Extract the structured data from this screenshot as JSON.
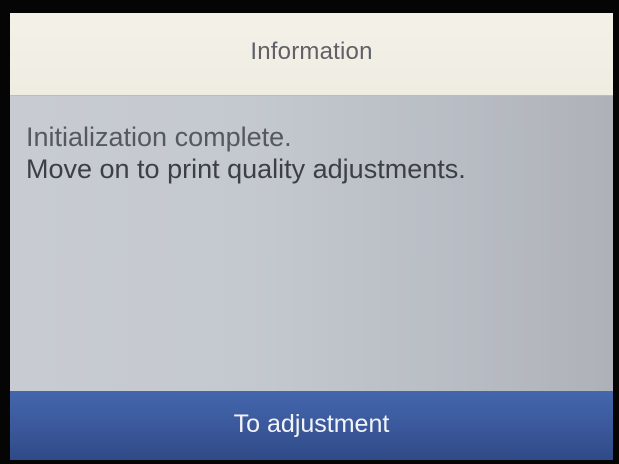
{
  "dialog": {
    "title": "Information",
    "message": {
      "line1": "Initialization complete.",
      "line2": "Move on to print quality adjustments."
    },
    "action_button": {
      "label": "To adjustment"
    }
  }
}
